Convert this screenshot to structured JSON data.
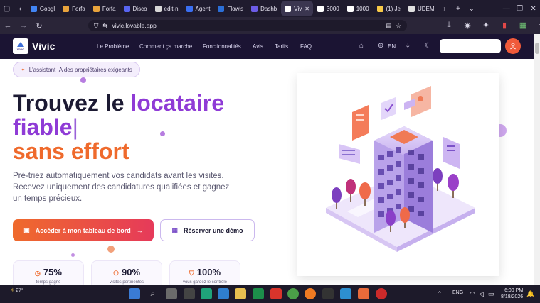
{
  "browser": {
    "tabs": [
      {
        "label": "Googl",
        "color": "#4285f4"
      },
      {
        "label": "Forfa",
        "color": "#e8a33c"
      },
      {
        "label": "Forfa",
        "color": "#e8a33c"
      },
      {
        "label": "Disco",
        "color": "#5865f2"
      },
      {
        "label": "edit-n",
        "color": "#d8d8d8"
      },
      {
        "label": "Agent",
        "color": "#3a6ff2"
      },
      {
        "label": "Flowis",
        "color": "#2b6fd8"
      },
      {
        "label": "Dashb",
        "color": "#6c5ce7"
      },
      {
        "label": "Viv",
        "color": "#ffffff",
        "active": true
      },
      {
        "label": "3000",
        "color": "#ffffff"
      },
      {
        "label": "1000",
        "color": "#ffffff"
      },
      {
        "label": "(1) Je",
        "color": "#f7c948"
      },
      {
        "label": "UDEM",
        "color": "#e0e0e0"
      }
    ],
    "url": "vivic.lovable.app"
  },
  "header": {
    "logo_small": "VIVIC",
    "logo_text": "Vivic",
    "nav": [
      "Le Problème",
      "Comment ça marche",
      "Fonctionnalités",
      "Avis",
      "Tarifs",
      "FAQ"
    ],
    "lang": "EN"
  },
  "hero": {
    "badge": "L'assistant IA des propriétaires exigeants",
    "line1_a": "Trouvez le ",
    "line1_b": "locataire",
    "line2": "fiable",
    "line3": "sans effort",
    "subtitle": "Pré-triez automatiquement vos candidats avant les visites. Recevez uniquement des candidatures qualifiées et gagnez un temps précieux.",
    "primary_cta": "Accéder à mon tableau de bord",
    "secondary_cta": "Réserver une démo",
    "stats": [
      {
        "value": "75%",
        "label": "temps gagné"
      },
      {
        "value": "90%",
        "label": "visites pertinentes"
      },
      {
        "value": "100%",
        "label": "vous gardez le contrôle"
      }
    ]
  },
  "taskbar": {
    "weather": "27°",
    "lang": "ENG",
    "time": "6:00 PM",
    "date": "8/18/2026"
  }
}
